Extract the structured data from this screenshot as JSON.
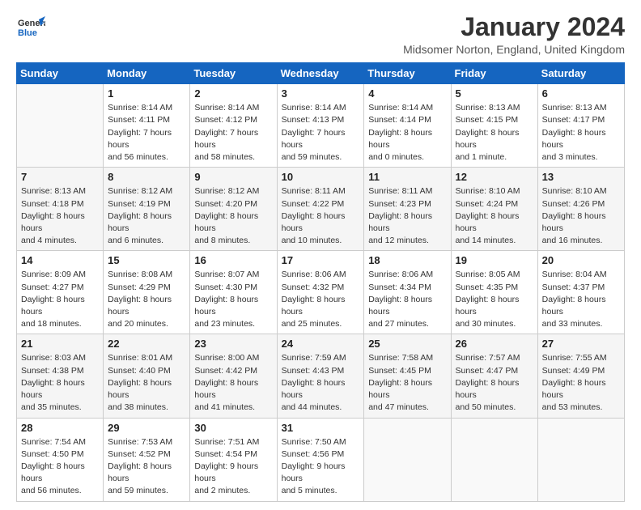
{
  "logo": {
    "general": "General",
    "blue": "Blue"
  },
  "title": "January 2024",
  "location": "Midsomer Norton, England, United Kingdom",
  "weekdays": [
    "Sunday",
    "Monday",
    "Tuesday",
    "Wednesday",
    "Thursday",
    "Friday",
    "Saturday"
  ],
  "weeks": [
    [
      {
        "day": "",
        "sunrise": "",
        "sunset": "",
        "daylight": ""
      },
      {
        "day": "1",
        "sunrise": "Sunrise: 8:14 AM",
        "sunset": "Sunset: 4:11 PM",
        "daylight": "Daylight: 7 hours and 56 minutes."
      },
      {
        "day": "2",
        "sunrise": "Sunrise: 8:14 AM",
        "sunset": "Sunset: 4:12 PM",
        "daylight": "Daylight: 7 hours and 58 minutes."
      },
      {
        "day": "3",
        "sunrise": "Sunrise: 8:14 AM",
        "sunset": "Sunset: 4:13 PM",
        "daylight": "Daylight: 7 hours and 59 minutes."
      },
      {
        "day": "4",
        "sunrise": "Sunrise: 8:14 AM",
        "sunset": "Sunset: 4:14 PM",
        "daylight": "Daylight: 8 hours and 0 minutes."
      },
      {
        "day": "5",
        "sunrise": "Sunrise: 8:13 AM",
        "sunset": "Sunset: 4:15 PM",
        "daylight": "Daylight: 8 hours and 1 minute."
      },
      {
        "day": "6",
        "sunrise": "Sunrise: 8:13 AM",
        "sunset": "Sunset: 4:17 PM",
        "daylight": "Daylight: 8 hours and 3 minutes."
      }
    ],
    [
      {
        "day": "7",
        "sunrise": "Sunrise: 8:13 AM",
        "sunset": "Sunset: 4:18 PM",
        "daylight": "Daylight: 8 hours and 4 minutes."
      },
      {
        "day": "8",
        "sunrise": "Sunrise: 8:12 AM",
        "sunset": "Sunset: 4:19 PM",
        "daylight": "Daylight: 8 hours and 6 minutes."
      },
      {
        "day": "9",
        "sunrise": "Sunrise: 8:12 AM",
        "sunset": "Sunset: 4:20 PM",
        "daylight": "Daylight: 8 hours and 8 minutes."
      },
      {
        "day": "10",
        "sunrise": "Sunrise: 8:11 AM",
        "sunset": "Sunset: 4:22 PM",
        "daylight": "Daylight: 8 hours and 10 minutes."
      },
      {
        "day": "11",
        "sunrise": "Sunrise: 8:11 AM",
        "sunset": "Sunset: 4:23 PM",
        "daylight": "Daylight: 8 hours and 12 minutes."
      },
      {
        "day": "12",
        "sunrise": "Sunrise: 8:10 AM",
        "sunset": "Sunset: 4:24 PM",
        "daylight": "Daylight: 8 hours and 14 minutes."
      },
      {
        "day": "13",
        "sunrise": "Sunrise: 8:10 AM",
        "sunset": "Sunset: 4:26 PM",
        "daylight": "Daylight: 8 hours and 16 minutes."
      }
    ],
    [
      {
        "day": "14",
        "sunrise": "Sunrise: 8:09 AM",
        "sunset": "Sunset: 4:27 PM",
        "daylight": "Daylight: 8 hours and 18 minutes."
      },
      {
        "day": "15",
        "sunrise": "Sunrise: 8:08 AM",
        "sunset": "Sunset: 4:29 PM",
        "daylight": "Daylight: 8 hours and 20 minutes."
      },
      {
        "day": "16",
        "sunrise": "Sunrise: 8:07 AM",
        "sunset": "Sunset: 4:30 PM",
        "daylight": "Daylight: 8 hours and 23 minutes."
      },
      {
        "day": "17",
        "sunrise": "Sunrise: 8:06 AM",
        "sunset": "Sunset: 4:32 PM",
        "daylight": "Daylight: 8 hours and 25 minutes."
      },
      {
        "day": "18",
        "sunrise": "Sunrise: 8:06 AM",
        "sunset": "Sunset: 4:34 PM",
        "daylight": "Daylight: 8 hours and 27 minutes."
      },
      {
        "day": "19",
        "sunrise": "Sunrise: 8:05 AM",
        "sunset": "Sunset: 4:35 PM",
        "daylight": "Daylight: 8 hours and 30 minutes."
      },
      {
        "day": "20",
        "sunrise": "Sunrise: 8:04 AM",
        "sunset": "Sunset: 4:37 PM",
        "daylight": "Daylight: 8 hours and 33 minutes."
      }
    ],
    [
      {
        "day": "21",
        "sunrise": "Sunrise: 8:03 AM",
        "sunset": "Sunset: 4:38 PM",
        "daylight": "Daylight: 8 hours and 35 minutes."
      },
      {
        "day": "22",
        "sunrise": "Sunrise: 8:01 AM",
        "sunset": "Sunset: 4:40 PM",
        "daylight": "Daylight: 8 hours and 38 minutes."
      },
      {
        "day": "23",
        "sunrise": "Sunrise: 8:00 AM",
        "sunset": "Sunset: 4:42 PM",
        "daylight": "Daylight: 8 hours and 41 minutes."
      },
      {
        "day": "24",
        "sunrise": "Sunrise: 7:59 AM",
        "sunset": "Sunset: 4:43 PM",
        "daylight": "Daylight: 8 hours and 44 minutes."
      },
      {
        "day": "25",
        "sunrise": "Sunrise: 7:58 AM",
        "sunset": "Sunset: 4:45 PM",
        "daylight": "Daylight: 8 hours and 47 minutes."
      },
      {
        "day": "26",
        "sunrise": "Sunrise: 7:57 AM",
        "sunset": "Sunset: 4:47 PM",
        "daylight": "Daylight: 8 hours and 50 minutes."
      },
      {
        "day": "27",
        "sunrise": "Sunrise: 7:55 AM",
        "sunset": "Sunset: 4:49 PM",
        "daylight": "Daylight: 8 hours and 53 minutes."
      }
    ],
    [
      {
        "day": "28",
        "sunrise": "Sunrise: 7:54 AM",
        "sunset": "Sunset: 4:50 PM",
        "daylight": "Daylight: 8 hours and 56 minutes."
      },
      {
        "day": "29",
        "sunrise": "Sunrise: 7:53 AM",
        "sunset": "Sunset: 4:52 PM",
        "daylight": "Daylight: 8 hours and 59 minutes."
      },
      {
        "day": "30",
        "sunrise": "Sunrise: 7:51 AM",
        "sunset": "Sunset: 4:54 PM",
        "daylight": "Daylight: 9 hours and 2 minutes."
      },
      {
        "day": "31",
        "sunrise": "Sunrise: 7:50 AM",
        "sunset": "Sunset: 4:56 PM",
        "daylight": "Daylight: 9 hours and 5 minutes."
      },
      {
        "day": "",
        "sunrise": "",
        "sunset": "",
        "daylight": ""
      },
      {
        "day": "",
        "sunrise": "",
        "sunset": "",
        "daylight": ""
      },
      {
        "day": "",
        "sunrise": "",
        "sunset": "",
        "daylight": ""
      }
    ]
  ]
}
